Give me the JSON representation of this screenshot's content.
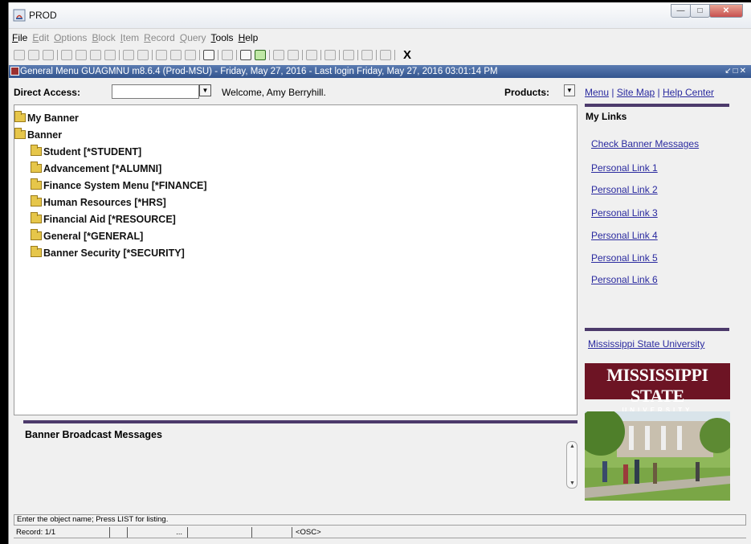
{
  "window": {
    "title": "PROD"
  },
  "menubar": [
    {
      "label": "File",
      "u": "F",
      "rest": "ile",
      "dim": false
    },
    {
      "label": "Edit",
      "u": "E",
      "rest": "dit",
      "dim": true
    },
    {
      "label": "Options",
      "u": "O",
      "rest": "ptions",
      "dim": true
    },
    {
      "label": "Block",
      "u": "B",
      "rest": "lock",
      "dim": true
    },
    {
      "label": "Item",
      "u": "I",
      "rest": "tem",
      "dim": true
    },
    {
      "label": "Record",
      "u": "R",
      "rest": "ecord",
      "dim": true
    },
    {
      "label": "Query",
      "u": "Q",
      "rest": "uery",
      "dim": true
    },
    {
      "label": "Tools",
      "u": "T",
      "rest": "ools",
      "dim": false
    },
    {
      "label": "Help",
      "u": "H",
      "rest": "elp",
      "dim": false
    }
  ],
  "toolbar": {
    "exit_label": "X"
  },
  "form": {
    "title": "General Menu  GUAGMNU  m8.6.4  (Prod-MSU) - Friday, May 27, 2016 - Last login Friday, May 27, 2016 03:01:14 PM",
    "direct_access_label": "Direct Access:",
    "direct_access_value": "",
    "welcome": "Welcome, Amy Berryhill.",
    "products_label": "Products:"
  },
  "tree": [
    {
      "label": "My Banner",
      "level": 1,
      "open": false
    },
    {
      "label": "Banner",
      "level": 1,
      "open": true
    },
    {
      "label": "Student [*STUDENT]",
      "level": 2
    },
    {
      "label": "Advancement [*ALUMNI]",
      "level": 2
    },
    {
      "label": "Finance System Menu [*FINANCE]",
      "level": 2
    },
    {
      "label": "Human Resources [*HRS]",
      "level": 2
    },
    {
      "label": "Financial Aid [*RESOURCE]",
      "level": 2
    },
    {
      "label": "General [*GENERAL]",
      "level": 2
    },
    {
      "label": "Banner Security [*SECURITY]",
      "level": 2
    }
  ],
  "broadcast": {
    "title": "Banner Broadcast Messages"
  },
  "right_panel": {
    "top_links": [
      "Menu",
      "Site Map",
      "Help Center"
    ],
    "my_links_title": "My Links",
    "links": [
      "Check Banner Messages",
      "Personal Link 1",
      "Personal Link 2",
      "Personal Link 3",
      "Personal Link 4",
      "Personal Link 5",
      "Personal Link 6"
    ],
    "university_link": "Mississippi State University",
    "logo_line1": "MISSISSIPPI STATE",
    "logo_line2": "UNIVERSITY"
  },
  "status": {
    "hint": "Enter the object name; Press LIST for listing.",
    "record": "Record: 1/1",
    "ellipsis": "...",
    "mode": "<OSC>"
  },
  "colors": {
    "accent_bar": "#4c3a6b",
    "link": "#2a2a9f",
    "msu_maroon": "#6d1424",
    "titlebar_blue": "#3d5f99"
  }
}
